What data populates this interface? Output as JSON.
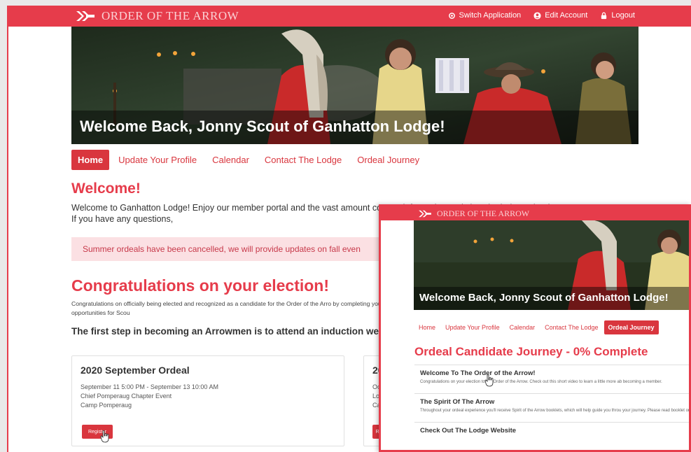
{
  "app": {
    "brand": "ORDER OF THE ARROW",
    "nav": [
      {
        "label": "Switch Application",
        "icon": "switch-icon"
      },
      {
        "label": "Edit Account",
        "icon": "account-icon"
      },
      {
        "label": "Logout",
        "icon": "lock-icon"
      }
    ],
    "colors": {
      "primary": "#e63c4b",
      "alert_bg": "#fbe0e3"
    }
  },
  "hero": {
    "caption": "Welcome Back, Jonny Scout of Ganhatton Lodge!"
  },
  "tabs": [
    {
      "label": "Home",
      "active": true
    },
    {
      "label": "Update Your Profile"
    },
    {
      "label": "Calendar"
    },
    {
      "label": "Contact The Lodge"
    },
    {
      "label": "Ordeal Journey"
    }
  ],
  "main": {
    "welcome_heading": "Welcome!",
    "welcome_text": "Welcome to Ganhatton Lodge! Enjoy our member portal and the vast amount contact information and view the lodge calendar. If you have any questions,",
    "alert": "Summer ordeals have been cancelled, we will provide updates on fall even",
    "congrats_heading": "Congratulations on your election!",
    "congrats_text": "Congratulations on officially being elected and recognized as a candidate for the Order of the Arro by completing your induction! The Order of the Arrow provides many great opportunities for Scou",
    "first_step": "The first step in becoming an Arrowmen is to attend an induction weekend."
  },
  "events": [
    {
      "title": "2020 September Ordeal",
      "lines": [
        "September 11 5:00 PM - September 13 10:00 AM",
        "Chief Pomperaug Chapter Event",
        "Camp Pomperaug"
      ],
      "button": "Register"
    },
    {
      "title": "20",
      "lines": [
        "Oc",
        "Lo",
        "Ca"
      ],
      "button": "R"
    }
  ],
  "overlay": {
    "brand": "ORDER OF THE ARROW",
    "caption": "Welcome Back, Jonny Scout of Ganhatton Lodge!",
    "tabs": [
      {
        "label": "Home"
      },
      {
        "label": "Update Your Profile"
      },
      {
        "label": "Calendar"
      },
      {
        "label": "Contact The Lodge"
      },
      {
        "label": "Ordeal Journey",
        "active": true
      }
    ],
    "title": "Ordeal Candidate Journey - 0% Complete",
    "progress_percent": 0,
    "items": [
      {
        "title": "Welcome To The Order of the Arrow!",
        "desc": "Congratulations on your election to the Order of the Arrow. Check out this short video to learn a little more ab becoming a member."
      },
      {
        "title": "The Spirit Of The Arrow",
        "desc": "Throughout your ordeal experience you'll receive Spirit of the Arrow booklets, which will help guide you throu your journey. Please read booklet one now."
      },
      {
        "title": "Check Out The Lodge Website",
        "desc": ""
      }
    ]
  }
}
